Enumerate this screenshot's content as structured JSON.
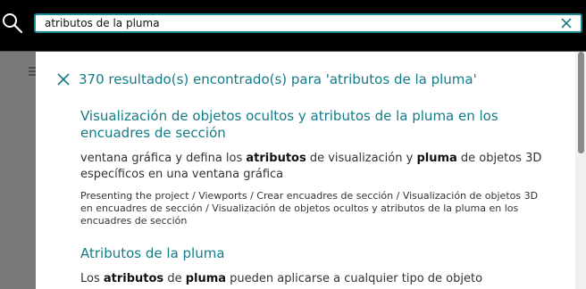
{
  "search": {
    "value": "atributos de la pluma"
  },
  "results": {
    "count_text": "370 resultado(s) encontrado(s) para 'atributos de la pluma'",
    "items": [
      {
        "title": "Visualización de objetos ocultos y atributos de la pluma en los encuadres de sección",
        "snippet_parts": [
          "ventana gráfica y defina los ",
          "atributos",
          " de visualización y ",
          "pluma",
          " de objetos 3D específicos en una ventana gráfica"
        ],
        "path": "Presenting the project / Viewports / Crear encuadres de sección / Visualización de objetos 3D en encuadres de sección / Visualización de objetos ocultos y atributos de la pluma en los encuadres de sección"
      },
      {
        "title": "Atributos de la pluma",
        "snippet_parts": [
          "Los ",
          "atributos",
          " de ",
          "pluma",
          " pueden aplicarse a cualquier tipo de objeto"
        ]
      }
    ]
  },
  "colors": {
    "accent": "#137c87",
    "search_border": "#1a8a92",
    "topbar": "#000000",
    "backdrop": "#7a7a7a"
  },
  "icons": {
    "search": "search-icon",
    "clear": "close-icon",
    "close_results": "close-icon",
    "menu": "hamburger-menu-icon"
  }
}
